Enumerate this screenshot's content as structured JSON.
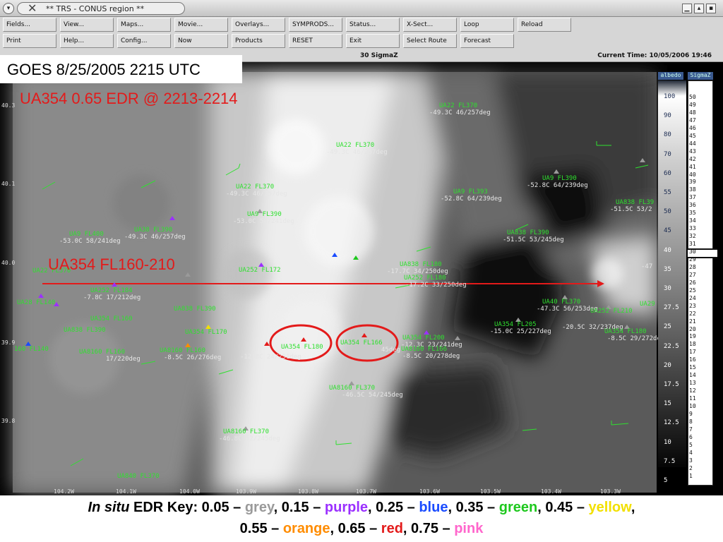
{
  "window": {
    "title": "** TRS - CONUS region **",
    "close_glyph": "✕",
    "menu_glyph": "▾"
  },
  "toolbar": {
    "row1": [
      "Fields...",
      "View...",
      "Maps...",
      "Movie...",
      "Overlays...",
      "SYMPRODS...",
      "Status...",
      "X-Sect...",
      "Loop",
      "Reload"
    ],
    "row2": [
      "Print",
      "Help...",
      "Config...",
      "Now",
      "Products",
      "RESET",
      "Exit",
      "Select Route",
      "Forecast"
    ]
  },
  "status": {
    "field": "30 SigmaZ",
    "current_time": "Current Time: 10/05/2006 19:46"
  },
  "overlay": {
    "goes_label": "GOES 8/25/2005 2215 UTC",
    "edr_label": "UA354 0.65 EDR @ 2213-2214",
    "route_label": "UA354 FL160-210"
  },
  "lat_labels": [
    "40.3",
    "40.1",
    "40.0",
    "39.9",
    "39.8"
  ],
  "lon_labels": [
    "104.2W",
    "104.1W",
    "104.0W",
    "103.9W",
    "103.8W",
    "103.7W",
    "103.6W",
    "103.5W",
    "103.4W",
    "103.3W"
  ],
  "albedo_scale": {
    "title": "albedo",
    "ticks": [
      "100",
      "90",
      "80",
      "70",
      "60",
      "55",
      "50",
      "45",
      "40",
      "35",
      "30",
      "27.5",
      "25",
      "22.5",
      "20",
      "17.5",
      "15",
      "12.5",
      "10",
      "7.5",
      "5"
    ]
  },
  "sigma_scale": {
    "title": "SigmaZ",
    "ticks": [
      "50",
      "49",
      "48",
      "47",
      "46",
      "45",
      "44",
      "43",
      "42",
      "41",
      "40",
      "39",
      "38",
      "37",
      "36",
      "35",
      "34",
      "33",
      "32",
      "31",
      "30",
      "29",
      "28",
      "27",
      "26",
      "25",
      "24",
      "23",
      "22",
      "21",
      "20",
      "19",
      "18",
      "17",
      "16",
      "15",
      "14",
      "13",
      "12",
      "11",
      "10",
      "9",
      "8",
      "7",
      "6",
      "5",
      "4",
      "3",
      "2",
      "1"
    ]
  },
  "flights": [
    {
      "label": "UA22 FL370",
      "detail": "-49.3C 46/257deg"
    },
    {
      "label": "UA22 FL370",
      "detail": "-49.3C 46/257deg"
    },
    {
      "label": "UA22 FL370",
      "detail": "-49.3C 46/257deg"
    },
    {
      "label": "UA9 FL390",
      "detail": "-52.8C 64/239deg"
    },
    {
      "label": "UA9 FL393",
      "detail": "-52.8C 64/239deg"
    },
    {
      "label": "UA838 FL39",
      "detail": "-51.5C 53/2"
    },
    {
      "label": "UA838 FL390",
      "detail": "-51.5C 53/245deg"
    },
    {
      "label": "UA9 FL390",
      "detail": "-53.0C 58/241deg"
    },
    {
      "label": "UA9 FL400",
      "detail": "-53.0C 58/241deg"
    },
    {
      "label": "UA38 FL390",
      "detail": "-49.3C 46/257deg"
    },
    {
      "label": "UA252 FL172",
      "detail": ""
    },
    {
      "label": "UA838 FL180",
      "detail": "-17.7C 34/250deg"
    },
    {
      "label": "UA252 FL180",
      "detail": "-17.2C 33/250deg"
    },
    {
      "label": "UA252 FL184",
      "detail": "-7.8C 17/212deg"
    },
    {
      "label": "UA838 FL390",
      "detail": ""
    },
    {
      "label": "UA354 FL160",
      "detail": ""
    },
    {
      "label": "UA838 FL390",
      "detail": ""
    },
    {
      "label": "UA354 FL170",
      "detail": ""
    },
    {
      "label": "UA8160 FL160",
      "detail": "-8.5C 26/276deg"
    },
    {
      "label": "UA8160 FL160",
      "detail": "17/220deg"
    },
    {
      "label": "UA354 FL180",
      "detail": "-12.8C 24/251deg"
    },
    {
      "label": "UA354 FL166",
      "detail": "45deg"
    },
    {
      "label": "UA354 FL200",
      "detail": "-12.3C 23/241deg"
    },
    {
      "label": "UA8160 FL166",
      "detail": "-8.5C 20/278deg"
    },
    {
      "label": "UA354 FL205",
      "detail": "-15.0C 25/227deg"
    },
    {
      "label": "UA40 FL370",
      "detail": "-47.3C 56/253deg"
    },
    {
      "label": "UA252 FL210",
      "detail": "-20.5C 32/237deg"
    },
    {
      "label": "UA354 FL180",
      "detail": "-8.5C 29/272deg"
    },
    {
      "label": "UA8160 FL370",
      "detail": "-46.5C 54/245deg"
    },
    {
      "label": "UA8160 FL370",
      "detail": "-46.8C 52/245deg"
    },
    {
      "label": "UA840 FL370",
      "detail": ""
    },
    {
      "label": "UA28 FL140",
      "detail": ""
    },
    {
      "label": "160 FL140",
      "detail": ""
    },
    {
      "label": "UA22 FL370",
      "detail": ""
    },
    {
      "label": "UA29",
      "detail": "-47"
    }
  ],
  "key": {
    "lead_italic": "In situ",
    "lead": "EDR Key:",
    "items": [
      {
        "value": "0.05",
        "name": "grey",
        "color": "#9a9a9a"
      },
      {
        "value": "0.15",
        "name": "purple",
        "color": "#9b30ff"
      },
      {
        "value": "0.25",
        "name": "blue",
        "color": "#1a4cff"
      },
      {
        "value": "0.35",
        "name": "green",
        "color": "#1ec81e"
      },
      {
        "value": "0.45",
        "name": "yellow",
        "color": "#f2e000"
      },
      {
        "value": "0.55",
        "name": "orange",
        "color": "#ff8c00"
      },
      {
        "value": "0.65",
        "name": "red",
        "color": "#e31a1a"
      },
      {
        "value": "0.75",
        "name": "pink",
        "color": "#ff66cc"
      }
    ]
  }
}
